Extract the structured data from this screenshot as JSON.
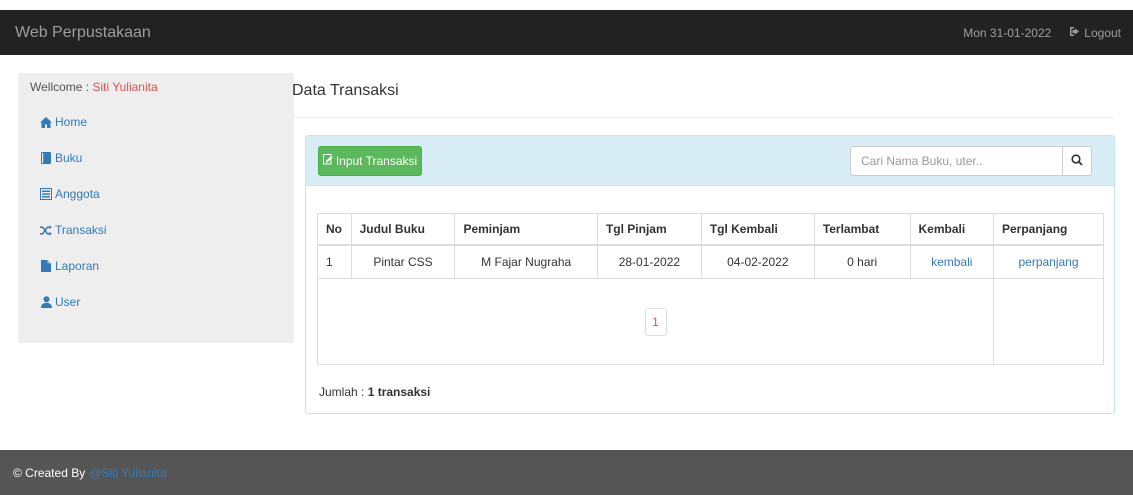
{
  "navbar": {
    "brand": "Web Perpustakaan",
    "date": "Mon 31-01-2022",
    "logout_label": "Logout",
    "logout_icon": "logout-icon"
  },
  "sidebar": {
    "welcome_prefix": "Wellcome : ",
    "user_name": "Siti Yulianita",
    "items": [
      {
        "label": "Home",
        "icon": "home-icon"
      },
      {
        "label": "Buku",
        "icon": "book-icon"
      },
      {
        "label": "Anggota",
        "icon": "list-icon"
      },
      {
        "label": "Transaksi",
        "icon": "shuffle-icon"
      },
      {
        "label": "Laporan",
        "icon": "file-icon"
      },
      {
        "label": "User",
        "icon": "user-icon"
      }
    ]
  },
  "main": {
    "title": "Data Transaksi",
    "input_button_label": "Input Transaksi",
    "search_placeholder": "Cari Nama Buku, uter..",
    "table": {
      "headers": [
        "No",
        "Judul Buku",
        "Peminjam",
        "Tgl Pinjam",
        "Tgl Kembali",
        "Terlambat",
        "Kembali",
        "Perpanjang"
      ],
      "rows": [
        [
          "1",
          "Pintar CSS",
          "M Fajar Nugraha",
          "28-01-2022",
          "04-02-2022",
          "0 hari",
          "kembali",
          "perpanjang"
        ]
      ]
    },
    "pagination_current": "1",
    "jumlah_prefix": "Jumlah : ",
    "jumlah_value": "1 transaksi"
  },
  "footer": {
    "prefix": "© Created By",
    "author": "@Siti Yulianita"
  },
  "colors": {
    "navbar_bg": "#222222",
    "footer_bg": "#555555",
    "sidebar_bg": "#eeeeee",
    "panel_heading_bg": "#d9edf7",
    "button_green": "#5cb85c",
    "link_blue": "#337ab7",
    "accent_red": "#d9534f"
  }
}
